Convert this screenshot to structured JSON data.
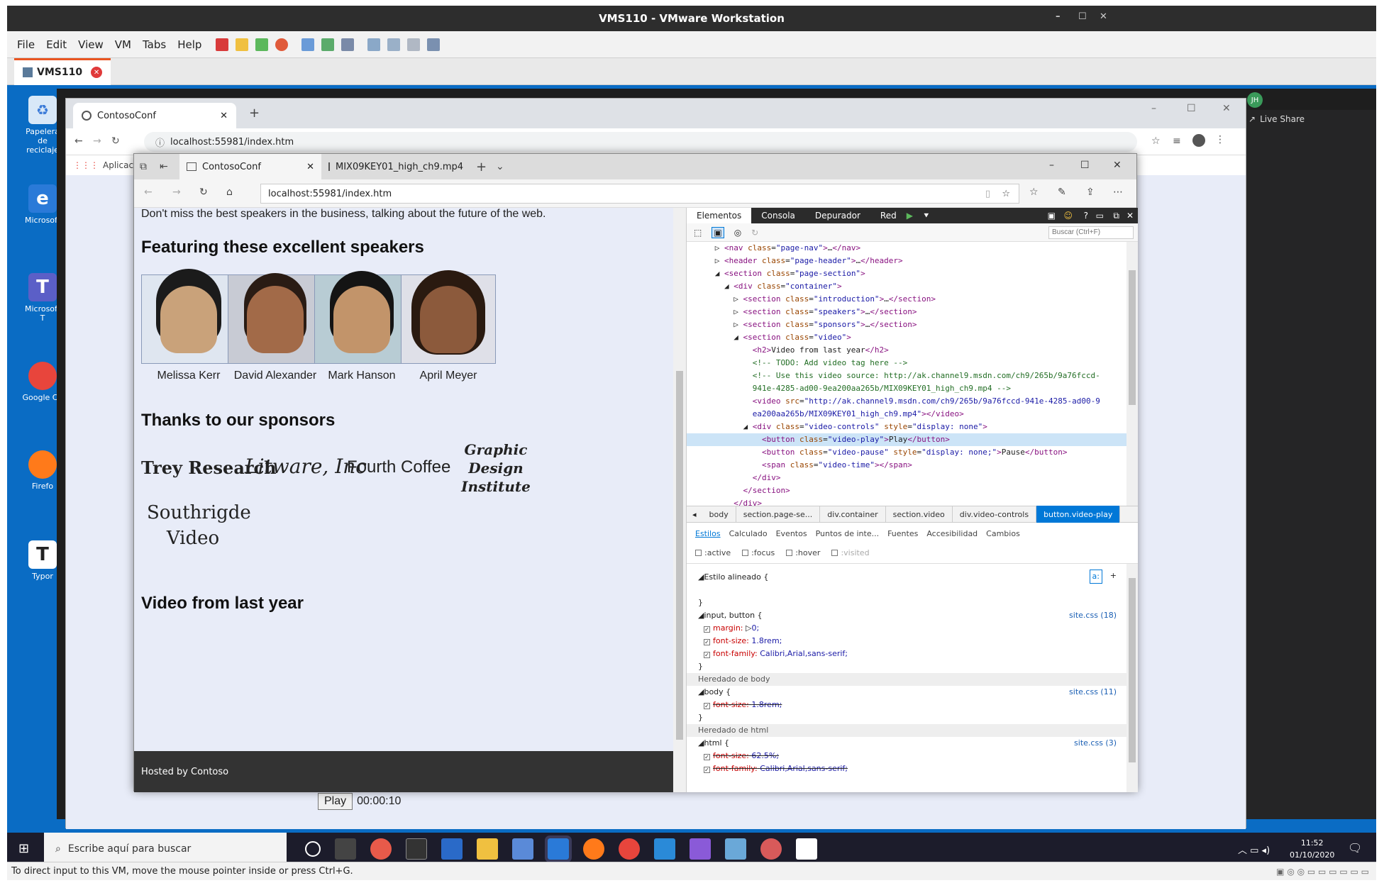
{
  "vm_title": "VMS110 - VMware Workstation",
  "vm_menu": [
    {
      "label": "File",
      "u": "F"
    },
    {
      "label": "Edit",
      "u": "E"
    },
    {
      "label": "View",
      "u": "V"
    },
    {
      "label": "VM",
      "u": "V"
    },
    {
      "label": "Tabs",
      "u": "T"
    },
    {
      "label": "Help",
      "u": "H"
    }
  ],
  "vm_tab": "VMS110",
  "desktop_icons": [
    "Papelera de reciclaje",
    "Microsoft",
    "Microsoft T",
    "Google Ch",
    "Firefo",
    "Typor"
  ],
  "vs": {
    "live_share": "Live Share",
    "initials": "JH"
  },
  "chrome": {
    "tab_title": "ContosoConf",
    "url": "localhost:55981/index.htm",
    "bookmarks": "Aplicacio"
  },
  "edge": {
    "tab1": "ContosoConf",
    "tab2": "MIX09KEY01_high_ch9.mp4",
    "url": "localhost:55981/index.htm"
  },
  "page": {
    "intro": "Don't miss the best speakers in the business, talking about the future of the web.",
    "speakers_heading": "Featuring these excellent speakers",
    "speakers": [
      "Melissa Kerr",
      "David Alexander",
      "Mark Hanson",
      "April Meyer"
    ],
    "sponsors_heading": "Thanks to our sponsors",
    "sponsors": [
      "Trey Research",
      "Litware, Inc",
      "Fourth Coffee",
      "Graphic Design Institute",
      "Southrigde Video"
    ],
    "video_heading": "Video from last year",
    "footer": "Hosted by Contoso"
  },
  "devtools": {
    "tabs": [
      "Elementos",
      "Consola",
      "Depurador",
      "Red"
    ],
    "search_placeholder": "Buscar (Ctrl+F)",
    "breadcrumbs": [
      "body",
      "section.page-se...",
      "div.container",
      "section.video",
      "div.video-controls",
      "button.video-play"
    ],
    "style_tabs": [
      "Estilos",
      "Calculado",
      "Eventos",
      "Puntos de inte...",
      "Fuentes",
      "Accesibilidad",
      "Cambios"
    ],
    "pseudo": [
      ":active",
      ":focus",
      ":hover",
      ":visited"
    ],
    "inline_style": "Estilo alineado",
    "rule1_selector": "input, button",
    "rule1_source": "site.css (18)",
    "rule1_props": [
      [
        "margin:",
        "0;"
      ],
      [
        "font-size:",
        "1.8rem;"
      ],
      [
        "font-family:",
        "Calibri,Arial,sans-serif;"
      ]
    ],
    "inherited_body": "Heredado de body",
    "rule2_selector": "body",
    "rule2_source": "site.css (11)",
    "rule2_props": [
      [
        "font-size:",
        "1.8rem;"
      ]
    ],
    "inherited_html": "Heredado de html",
    "rule3_selector": "html",
    "rule3_source": "site.css (3)",
    "rule3_props": [
      [
        "font-size:",
        "62.5%;"
      ],
      [
        "font-family:",
        "Calibri,Arial,sans-serif;"
      ]
    ]
  },
  "video_controls": {
    "play": "Play",
    "time": "00:00:10"
  },
  "taskbar": {
    "search": "Escribe aquí para buscar",
    "time": "11:52",
    "date": "01/10/2020"
  },
  "status": "To direct input to this VM, move the mouse pointer inside or press Ctrl+G."
}
